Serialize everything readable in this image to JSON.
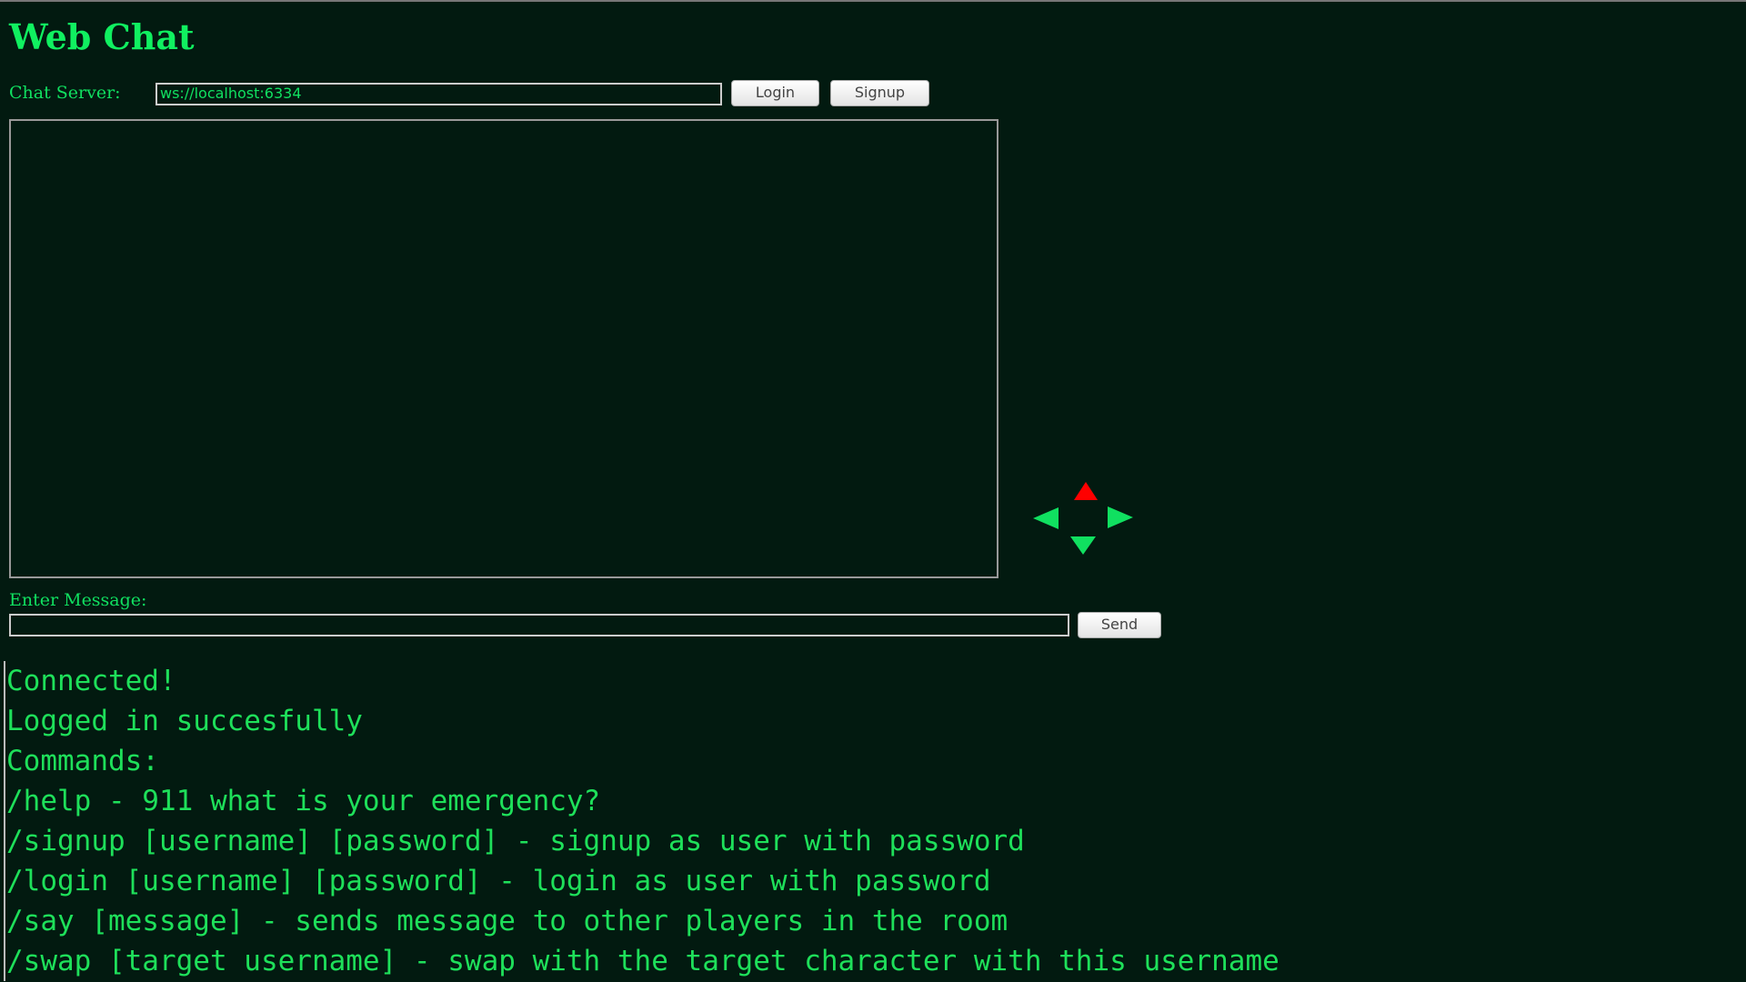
{
  "header": {
    "title": "Web Chat"
  },
  "server": {
    "label": "Chat Server:",
    "value": "ws://localhost:6334",
    "login_label": "Login",
    "signup_label": "Signup"
  },
  "message": {
    "label": "Enter Message:",
    "value": "",
    "send_label": "Send"
  },
  "controls": {
    "active_direction": "up",
    "active_color": "#ff0000",
    "color": "#10e060"
  },
  "log": [
    "Connected!",
    "Logged in succesfully",
    "Commands:",
    "/help - 911 what is your emergency?",
    "/signup [username] [password] - signup as user with password",
    "/login [username] [password] - login as user with password",
    "/say [message] - sends message to other players in the room",
    "/swap [target username] - swap with the target character with this username"
  ]
}
